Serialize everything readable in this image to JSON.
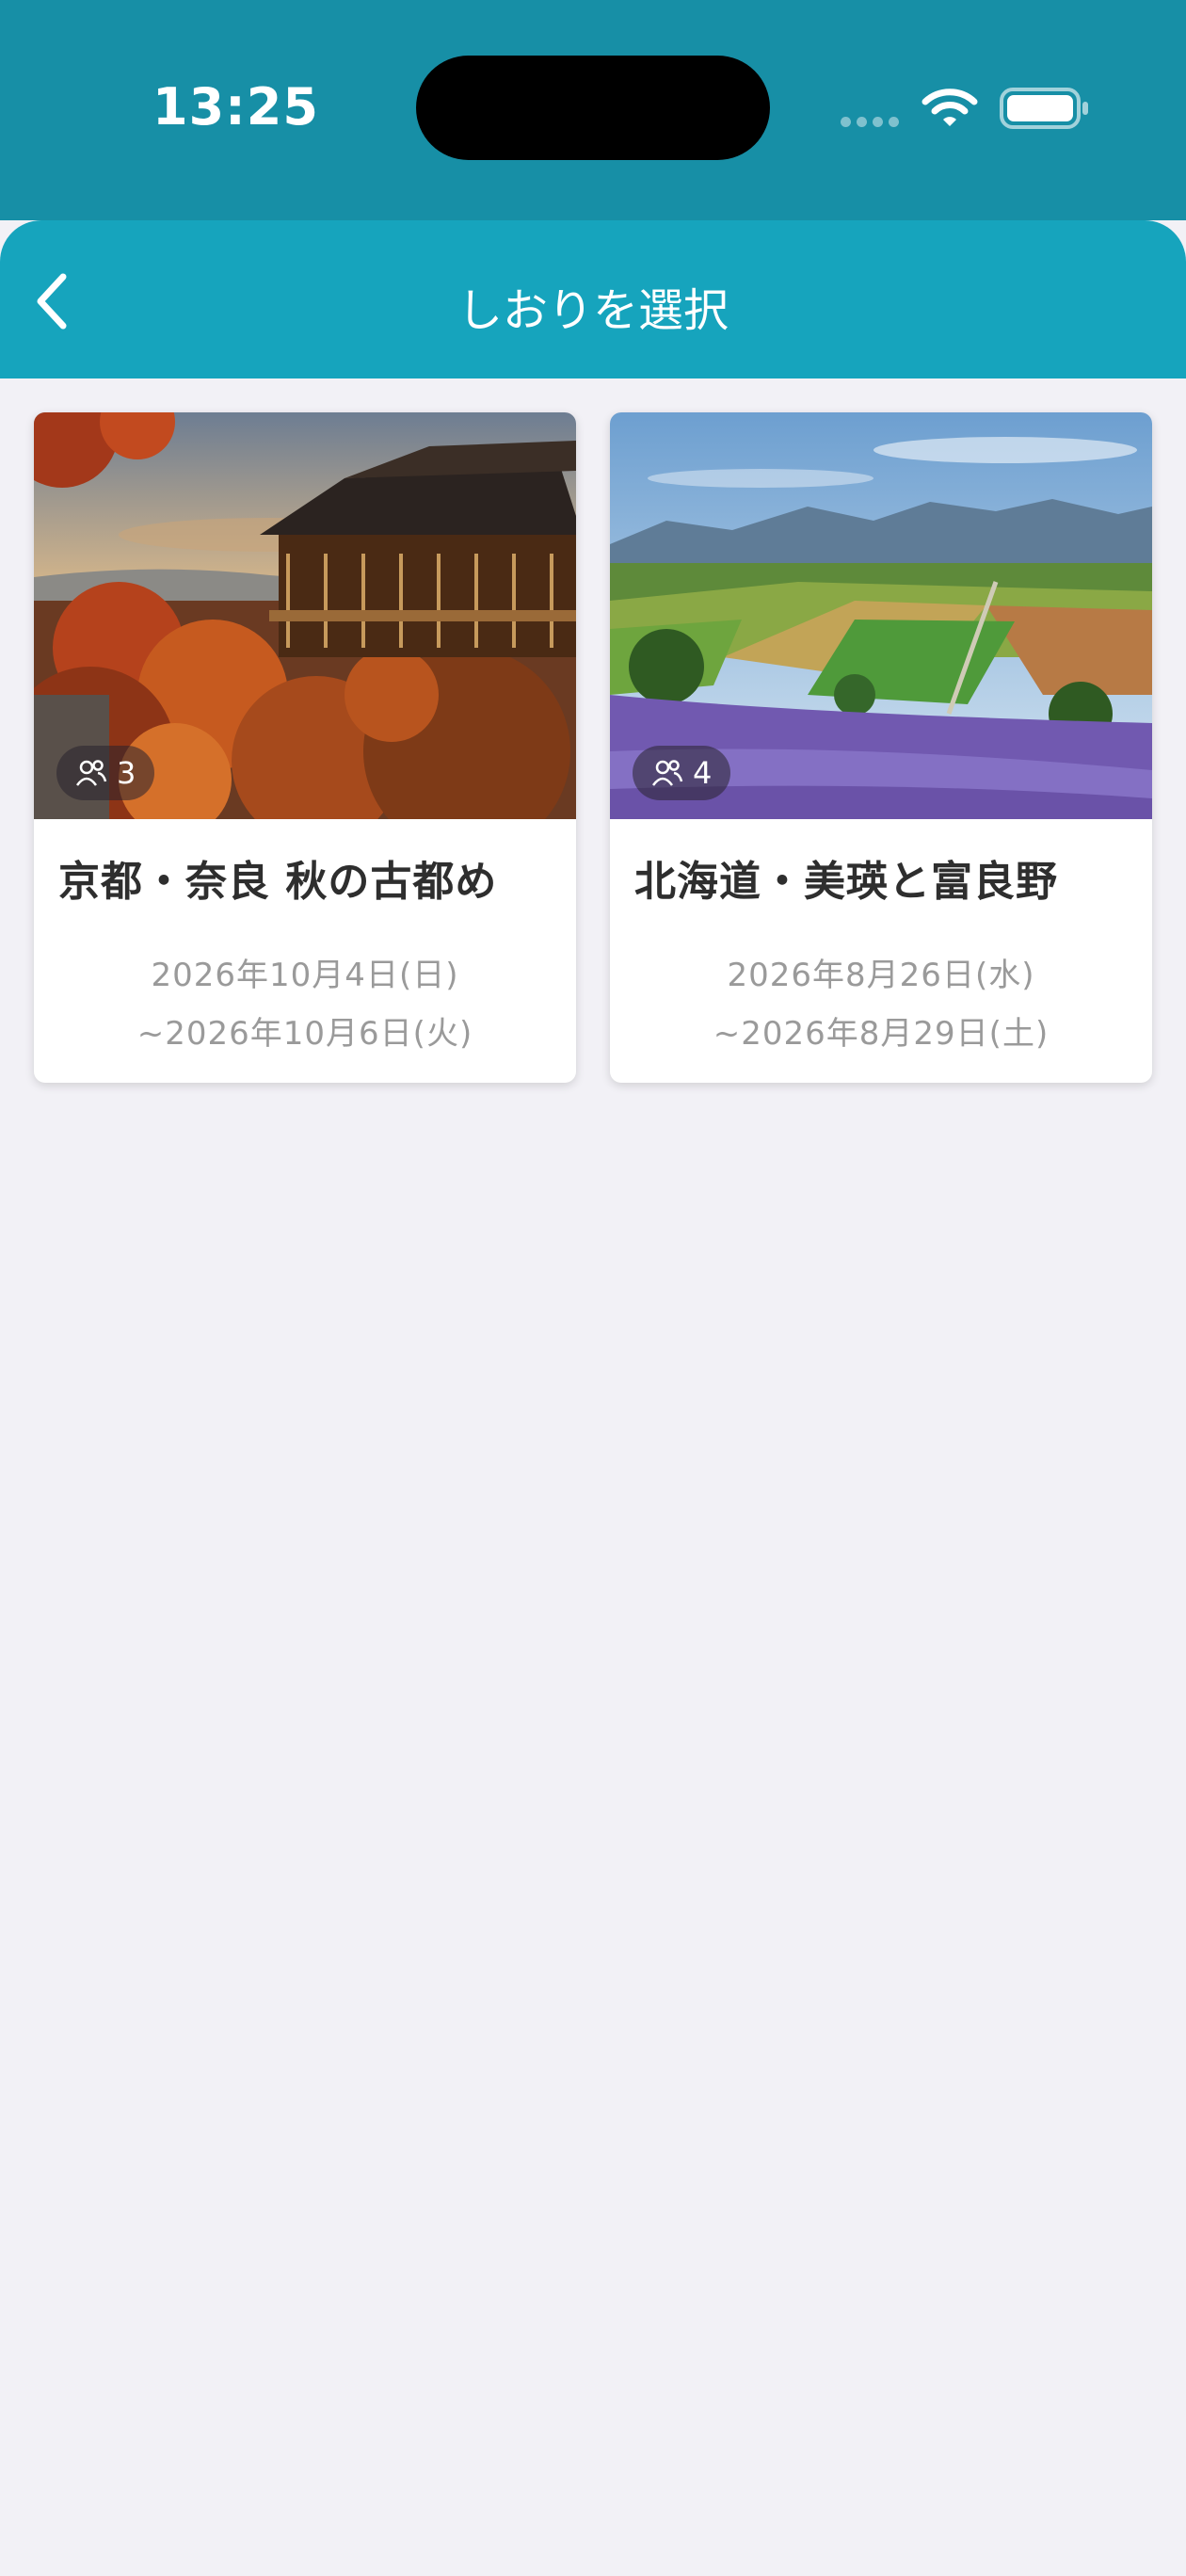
{
  "status_bar": {
    "time": "13:25",
    "icons": [
      "signal-dots-icon",
      "wifi-icon",
      "battery-icon"
    ]
  },
  "header": {
    "title": "しおりを選択",
    "back_icon": "chevron-left-icon"
  },
  "colors": {
    "status_bar_bg": "#178fa6",
    "header_bg": "#16a4bd",
    "page_bg": "#f2f1f6",
    "title_text": "#2e2e2e",
    "date_text": "#9a9a9a"
  },
  "trips": [
    {
      "image": "kyoto-temple-autumn-photo",
      "members": "3",
      "title": "京都・奈良 秋の古都め",
      "start_date": "2026年10月4日(日)",
      "end_date": "~2026年10月6日(火)"
    },
    {
      "image": "hokkaido-lavender-fields-photo",
      "members": "4",
      "title": "北海道・美瑛と富良野",
      "start_date": "2026年8月26日(水)",
      "end_date": "~2026年8月29日(土)"
    }
  ]
}
